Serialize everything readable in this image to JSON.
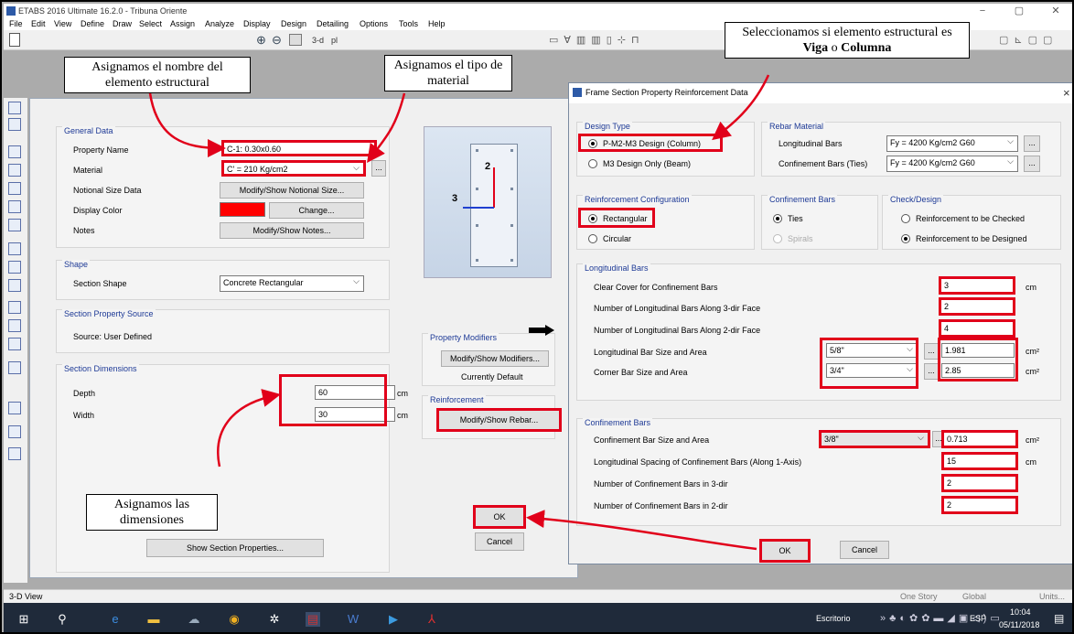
{
  "app": {
    "title": "ETABS 2016 Ultimate 16.2.0 - Tribuna Oriente",
    "min": "−",
    "max": "▢",
    "close": "✕"
  },
  "menu": [
    "File",
    "Edit",
    "View",
    "Define",
    "Draw",
    "Select",
    "Assign",
    "Analyze",
    "Display",
    "Design",
    "Detailing",
    "Options",
    "Tools",
    "Help"
  ],
  "toolbar": {
    "view3d": "3-d",
    "plan": "pl"
  },
  "callouts": {
    "name": "Asignamos el nombre del elemento estructural",
    "material": "Asignamos el tipo de material",
    "type_pre": "Seleccionamos si elemento estructural es ",
    "type_b1": "Viga",
    "type_mid": " o ",
    "type_b2": "Columna",
    "dims": "Asignamos las dimensiones"
  },
  "left": {
    "general_data": "General Data",
    "property_name_label": "Property Name",
    "property_name": "C-1: 0.30x0.60",
    "material_label": "Material",
    "material": "C' = 210 Kg/cm2",
    "notional_label": "Notional Size Data",
    "notional_btn": "Modify/Show Notional Size...",
    "color_label": "Display Color",
    "change_btn": "Change...",
    "notes_label": "Notes",
    "notes_btn": "Modify/Show Notes...",
    "shape": "Shape",
    "section_shape_label": "Section Shape",
    "section_shape": "Concrete Rectangular",
    "source_group": "Section Property Source",
    "source": "Source:  User Defined",
    "dims_group": "Section Dimensions",
    "depth_label": "Depth",
    "depth": "60",
    "width_label": "Width",
    "width": "30",
    "unit": "cm",
    "axis3": "3",
    "axis2": "2",
    "modifiers_group": "Property Modifiers",
    "modifiers_btn": "Modify/Show Modifiers...",
    "currently_default": "Currently Default",
    "reinforcement_group": "Reinforcement",
    "rebar_btn": "Modify/Show Rebar...",
    "show_props_btn": "Show Section Properties...",
    "ok": "OK",
    "cancel": "Cancel",
    "ellipsis": "..."
  },
  "right": {
    "title": "Frame Section Property Reinforcement Data",
    "close": "×",
    "design_type": "Design Type",
    "opt_column": "P-M2-M3 Design  (Column)",
    "opt_beam": "M3 Design Only  (Beam)",
    "rebar_material": "Rebar Material",
    "long_bars_label": "Longitudinal Bars",
    "long_bars": "Fy = 4200 Kg/cm2 G60",
    "conf_bars_label": "Confinement Bars (Ties)",
    "conf_bars": "Fy = 4200 Kg/cm2 G60",
    "reinf_config": "Reinforcement Configuration",
    "opt_rect": "Rectangular",
    "opt_circ": "Circular",
    "conf_group": "Confinement Bars",
    "opt_ties": "Ties",
    "opt_spirals": "Spirals",
    "check_group": "Check/Design",
    "opt_checked": "Reinforcement to be Checked",
    "opt_designed": "Reinforcement to be Designed",
    "long_group": "Longitudinal Bars",
    "clear_cover_label": "Clear Cover for Confinement Bars",
    "clear_cover": "3",
    "n3_label": "Number of Longitudinal Bars Along 3-dir Face",
    "n3": "2",
    "n2_label": "Number of Longitudinal Bars Along 2-dir Face",
    "n2": "4",
    "bar_size_label": "Longitudinal Bar Size and Area",
    "bar_size": "5/8\"",
    "bar_area": "1.981",
    "corner_label": "Corner Bar Size and Area",
    "corner_size": "3/4\"",
    "corner_area": "2.85",
    "confb_group": "Confinement Bars",
    "cb_size_label": "Confinement Bar Size and Area",
    "cb_size": "3/8\"",
    "cb_area": "0.713",
    "spacing_label": "Longitudinal Spacing of Confinement Bars  (Along 1-Axis)",
    "spacing": "15",
    "nc3_label": "Number of Confinement Bars in 3-dir",
    "nc3": "2",
    "nc2_label": "Number of Confinement Bars in 2-dir",
    "nc2": "2",
    "cm": "cm",
    "cm2": "cm²",
    "ok": "OK",
    "cancel": "Cancel",
    "ellipsis": "..."
  },
  "status": {
    "view": "3-D View",
    "story": "One Story",
    "global": "Global",
    "units": "Units..."
  },
  "taskbar": {
    "desktop": "Escritorio",
    "lang": "ESP",
    "time": "10:04",
    "date": "05/11/2018"
  },
  "colors": {
    "accent_red": "#e1001a",
    "display_color": "#ff0000",
    "taskbar": "#1f2a3a"
  },
  "icons": [
    "windows-start-icon",
    "search-icon",
    "edge-icon",
    "file-explorer-icon",
    "app-icon",
    "chrome-icon",
    "settings-icon",
    "etabs-icon",
    "word-icon",
    "media-icon",
    "acrobat-icon"
  ]
}
